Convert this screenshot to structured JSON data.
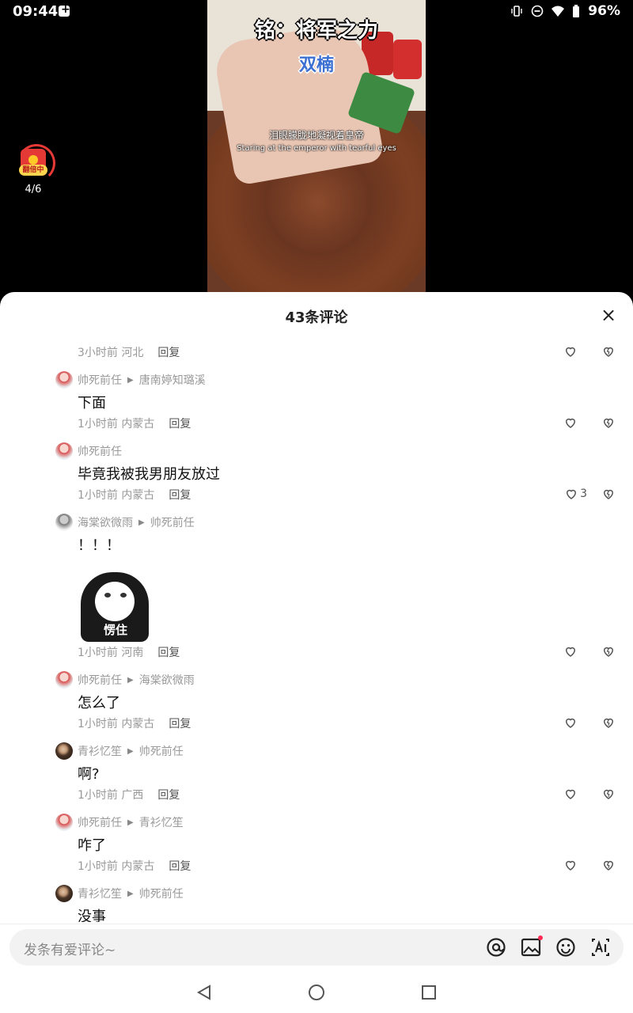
{
  "status": {
    "time": "09:44",
    "battery": "96%"
  },
  "video": {
    "title": "铭：将军之力",
    "subtitle": "双楠",
    "caption_zh": "泪眼朦胧地凝视着皇帝",
    "caption_en": "Staring at the emperor with tearful eyes"
  },
  "reward": {
    "tag": "翻倍中",
    "count": "4/6"
  },
  "sheet": {
    "title": "43条评论",
    "close": "×"
  },
  "partial": {
    "text": "…",
    "meta": "3小时前 河北",
    "reply": "回复"
  },
  "comments": [
    {
      "author": "帅死前任",
      "reply_to": "唐南婷知璐溪",
      "text": "下面",
      "meta": "1小时前 内蒙古",
      "reply": "回复",
      "likes": ""
    },
    {
      "author": "帅死前任",
      "reply_to": "",
      "text": "毕竟我被我男朋友放过",
      "meta": "1小时前 内蒙古",
      "reply": "回复",
      "likes": "3"
    },
    {
      "author": "海棠欲微雨",
      "reply_to": "帅死前任",
      "text": "！！！",
      "sticker": "愣住",
      "meta": "1小时前 河南",
      "reply": "回复",
      "likes": ""
    },
    {
      "author": "帅死前任",
      "reply_to": "海棠欲微雨",
      "text": "怎么了",
      "meta": "1小时前 内蒙古",
      "reply": "回复",
      "likes": ""
    },
    {
      "author": "青衫忆笙",
      "reply_to": "帅死前任",
      "text": "啊?",
      "meta": "1小时前 广西",
      "reply": "回复",
      "likes": ""
    },
    {
      "author": "帅死前任",
      "reply_to": "青衫忆笙",
      "text": "咋了",
      "meta": "1小时前 内蒙古",
      "reply": "回复",
      "likes": ""
    },
    {
      "author": "青衫忆笙",
      "reply_to": "帅死前任",
      "text": "没事"
    }
  ],
  "input": {
    "placeholder": "发条有爱评论~"
  },
  "icons": [
    "at-icon",
    "image-icon",
    "emoji-icon",
    "ai-icon",
    "heart-icon",
    "broken-heart-icon",
    "back-icon",
    "home-icon",
    "recents-icon"
  ]
}
